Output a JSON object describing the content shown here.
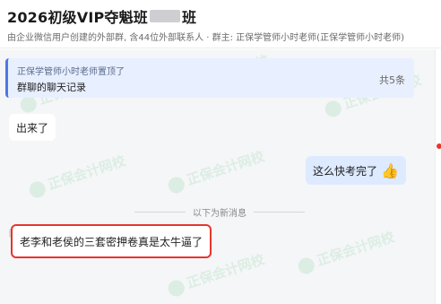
{
  "header": {
    "title": "2026初级VIP夺魁班",
    "title_suffix": "班",
    "subtitle": "由企业微信用户创建的外部群, 含44位外部联系人 · 群主: 正保学管师小时老师(正保学管师小时老师)"
  },
  "pinned": {
    "pinned_by": "正保学管师小时老师置顶了",
    "body": "群聊的聊天记录",
    "count": "共5条"
  },
  "messages": [
    {
      "text": "出来了",
      "side": "left"
    },
    {
      "text": "这么快考完了",
      "side": "right",
      "emoji": "thumbs-up-icon"
    },
    {
      "text": "老李和老侯的三套密押卷真是太牛逼了",
      "side": "left",
      "highlighted": true
    }
  ],
  "divider": {
    "text": "以下为新消息"
  },
  "watermark": {
    "text": "正保会计网校"
  },
  "colors": {
    "highlight_border": "#e8352b",
    "pinned_bg": "#e8efff",
    "self_bubble": "#ddeaff"
  }
}
